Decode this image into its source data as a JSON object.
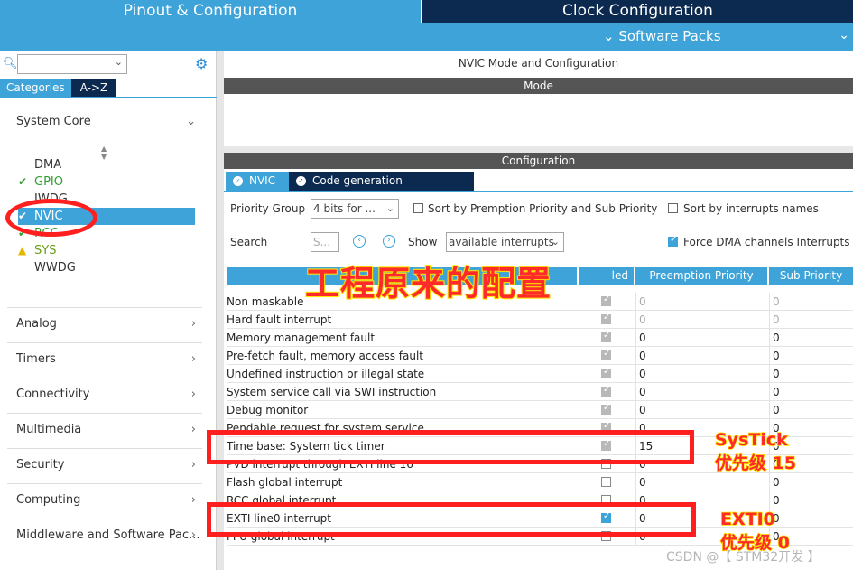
{
  "tabs": {
    "pinout": "Pinout & Configuration",
    "clock": "Clock Configuration"
  },
  "software_packs": "Software Packs",
  "left": {
    "category_tabs": [
      "Categories",
      "A->Z"
    ],
    "system_core": "System Core",
    "peripherals": [
      {
        "label": "DMA",
        "status": "none"
      },
      {
        "label": "GPIO",
        "status": "ok"
      },
      {
        "label": "IWDG",
        "status": "none"
      },
      {
        "label": "NVIC",
        "status": "selected"
      },
      {
        "label": "RCC",
        "status": "ok"
      },
      {
        "label": "SYS",
        "status": "warn"
      },
      {
        "label": "WWDG",
        "status": "none"
      }
    ],
    "sections": [
      "Analog",
      "Timers",
      "Connectivity",
      "Multimedia",
      "Security",
      "Computing",
      "Middleware and Software Pac..."
    ]
  },
  "right": {
    "title": "NVIC Mode and Configuration",
    "mode_bar": "Mode",
    "config_bar": "Configuration",
    "config_tabs": [
      "NVIC",
      "Code generation"
    ],
    "priority_group_label": "Priority Group",
    "priority_group_value": "4 bits for ...",
    "sort_preemption": "Sort by Premption Priority and Sub Priority",
    "sort_names": "Sort by interrupts names",
    "search_label": "Search",
    "search_placeholder": "S...",
    "show_label": "Show",
    "show_value": "available interrupts",
    "force_dma": "Force DMA channels Interrupts",
    "columns": {
      "enabled": "led",
      "preemption": "Preemption Priority",
      "sub": "Sub Priority"
    },
    "rows": [
      {
        "name": "Non maskable",
        "enabled": "checked",
        "pre": "0",
        "sub": "0",
        "dim": true
      },
      {
        "name": "Hard fault interrupt",
        "enabled": "checked",
        "pre": "0",
        "sub": "0",
        "dim": true
      },
      {
        "name": "Memory management fault",
        "enabled": "checked",
        "pre": "0",
        "sub": "0",
        "dim": false
      },
      {
        "name": "Pre-fetch fault, memory access fault",
        "enabled": "checked",
        "pre": "0",
        "sub": "0",
        "dim": false
      },
      {
        "name": "Undefined instruction or illegal state",
        "enabled": "checked",
        "pre": "0",
        "sub": "0",
        "dim": false
      },
      {
        "name": "System service call via SWI instruction",
        "enabled": "checked",
        "pre": "0",
        "sub": "0",
        "dim": false
      },
      {
        "name": "Debug monitor",
        "enabled": "checked",
        "pre": "0",
        "sub": "0",
        "dim": false
      },
      {
        "name": "Pendable request for system service",
        "enabled": "checked",
        "pre": "0",
        "sub": "0",
        "dim": false
      },
      {
        "name": "Time base: System tick timer",
        "enabled": "checked",
        "pre": "15",
        "sub": "0",
        "dim": false
      },
      {
        "name": "PVD interrupt through EXTI line 16",
        "enabled": "unchecked",
        "pre": "0",
        "sub": "0",
        "dim": false
      },
      {
        "name": "Flash global interrupt",
        "enabled": "unchecked",
        "pre": "0",
        "sub": "0",
        "dim": false
      },
      {
        "name": "RCC global interrupt",
        "enabled": "unchecked",
        "pre": "0",
        "sub": "0",
        "dim": false
      },
      {
        "name": "EXTI line0 interrupt",
        "enabled": "blue",
        "pre": "0",
        "sub": "0",
        "dim": false
      },
      {
        "name": "FPU global interrupt",
        "enabled": "unchecked",
        "pre": "0",
        "sub": "0",
        "dim": false
      }
    ]
  },
  "annotations": {
    "title": "工程原来的配置",
    "systick_note_1": "SysTick",
    "systick_note_2": "优先级 15",
    "exti_note_1": "EXTI0",
    "exti_note_2": "优先级 0"
  },
  "watermark": "CSDN @【 STM32开发 】"
}
